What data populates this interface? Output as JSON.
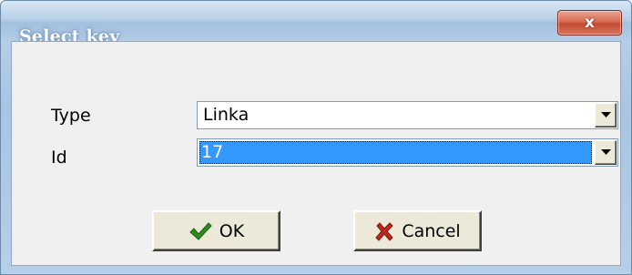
{
  "window": {
    "title": "Select key",
    "close_glyph": "x"
  },
  "form": {
    "type": {
      "label": "Type",
      "value": "Linka"
    },
    "id": {
      "label": "Id",
      "value": "17"
    }
  },
  "buttons": {
    "ok": {
      "label": "OK",
      "icon": "check-icon",
      "icon_color": "#2e8b1e"
    },
    "cancel": {
      "label": "Cancel",
      "icon": "cross-icon",
      "icon_color": "#c0281c"
    }
  },
  "colors": {
    "selection": "#3399ff",
    "dialog_face": "#f0f0f0",
    "close_button": "#c9543b"
  }
}
